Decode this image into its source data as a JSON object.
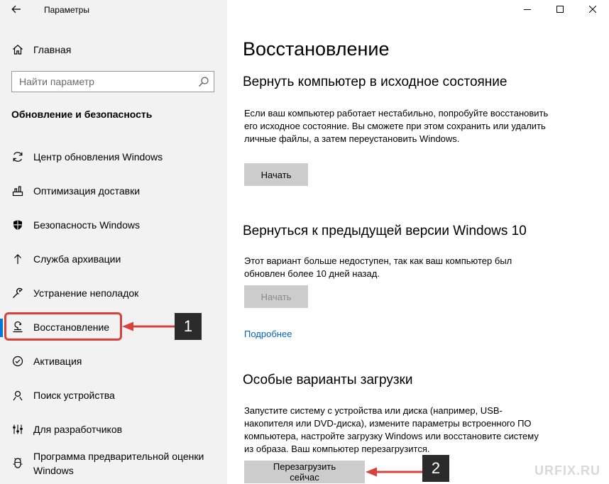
{
  "window": {
    "title": "Параметры",
    "controls": [
      "minimize-icon",
      "maximize-icon",
      "close-icon"
    ]
  },
  "sidebar": {
    "home_label": "Главная",
    "search": {
      "placeholder": "Найти параметр",
      "value": ""
    },
    "section_title": "Обновление и безопасность",
    "items": [
      {
        "label": "Центр обновления Windows",
        "icon": "sync-icon"
      },
      {
        "label": "Оптимизация доставки",
        "icon": "delivery-icon"
      },
      {
        "label": "Безопасность Windows",
        "icon": "shield-icon"
      },
      {
        "label": "Служба архивации",
        "icon": "backup-icon"
      },
      {
        "label": "Устранение неполадок",
        "icon": "wrench-icon"
      },
      {
        "label": "Восстановление",
        "icon": "recovery-icon",
        "selected": true
      },
      {
        "label": "Активация",
        "icon": "activation-icon"
      },
      {
        "label": "Поиск устройства",
        "icon": "find-device-icon"
      },
      {
        "label": "Для разработчиков",
        "icon": "developer-icon"
      },
      {
        "label": "Программа предварительной оценки\nWindows",
        "icon": "insider-icon"
      }
    ]
  },
  "main": {
    "title": "Восстановление",
    "reset": {
      "heading": "Вернуть компьютер в исходное состояние",
      "text": "Если ваш компьютер работает нестабильно, попробуйте восстановить его исходное состояние. Вы сможете при этом сохранить или удалить личные файлы, а затем переустановить Windows.",
      "button": "Начать"
    },
    "rollback": {
      "heading": "Вернуться к предыдущей версии Windows 10",
      "text": "Этот вариант больше недоступен, так как ваш компьютер был обновлен более 10 дней назад.",
      "button": "Начать",
      "link": "Подробнее"
    },
    "advanced": {
      "heading": "Особые варианты загрузки",
      "text": "Запустите систему с устройства или диска (например, USB-накопителя или DVD-диска), измените параметры встроенного ПО компьютера, настройте загрузку Windows или восстановите систему из образа. Ваш компьютер перезагрузится.",
      "button": "Перезагрузить сейчас"
    }
  },
  "annotations": {
    "badge1": "1",
    "badge2": "2",
    "color": "#d9423a"
  },
  "watermark": "URFIX.RU",
  "colors": {
    "accent": "#0078d7",
    "sidebar_bg": "#f2f2f2",
    "link": "#0066b4",
    "button_bg": "#cccccc"
  }
}
